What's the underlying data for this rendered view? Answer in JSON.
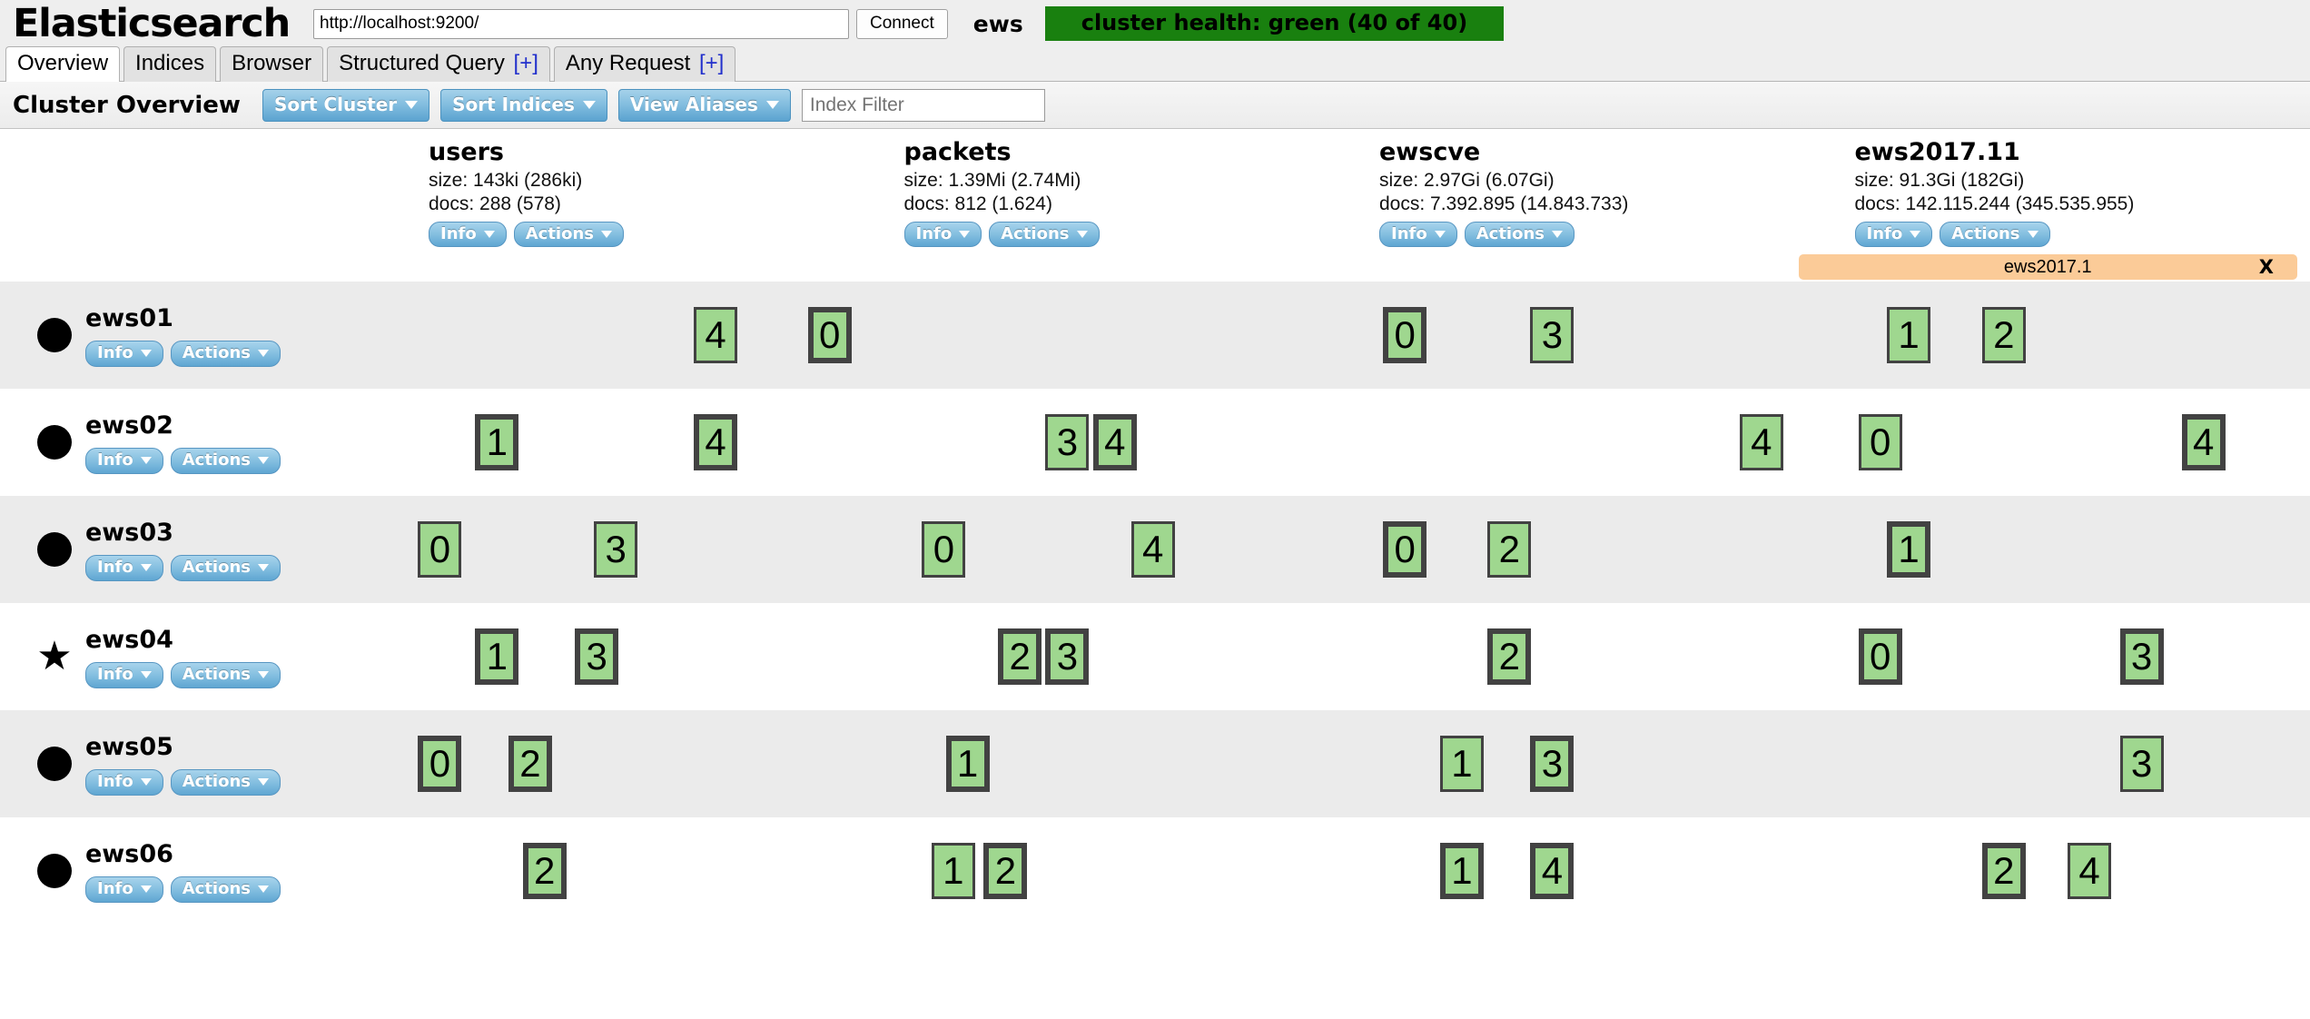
{
  "header": {
    "brand": "Elasticsearch",
    "url_value": "http://localhost:9200/",
    "url_placeholder": "http://localhost:9200/",
    "connect_label": "Connect",
    "cluster_name": "ews",
    "health_text": "cluster health: green (40 of 40)",
    "health_color": "#19800f"
  },
  "tabs": [
    {
      "label": "Overview",
      "plus": "",
      "active": true
    },
    {
      "label": "Indices",
      "plus": "",
      "active": false
    },
    {
      "label": "Browser",
      "plus": "",
      "active": false
    },
    {
      "label": "Structured Query",
      "plus": "[+]",
      "active": false
    },
    {
      "label": "Any Request",
      "plus": "[+]",
      "active": false
    }
  ],
  "toolbar": {
    "title": "Cluster Overview",
    "sort_cluster_label": "Sort Cluster",
    "sort_indices_label": "Sort Indices",
    "view_aliases_label": "View Aliases",
    "filter_placeholder": "Index Filter",
    "filter_value": ""
  },
  "pill_labels": {
    "info": "Info",
    "actions": "Actions"
  },
  "indices": [
    {
      "name": "users",
      "size": "size: 143ki (286ki)",
      "docs": "docs: 288 (578)",
      "alias": null
    },
    {
      "name": "packets",
      "size": "size: 1.39Mi (2.74Mi)",
      "docs": "docs: 812 (1.624)",
      "alias": null
    },
    {
      "name": "ewscve",
      "size": "size: 2.97Gi (6.07Gi)",
      "docs": "docs: 7.392.895 (14.843.733)",
      "alias": null
    },
    {
      "name": "ews2017.11",
      "size": "size: 91.3Gi (182Gi)",
      "docs": "docs: 142.115.244 (345.535.955)",
      "alias": {
        "label": "ews2017.1",
        "close": "X"
      }
    }
  ],
  "nodes": [
    {
      "name": "ews01",
      "marker": "circle-icon",
      "master": false,
      "shards": [
        {
          "index": 0,
          "num": "4",
          "primary": false,
          "x": 0.6
        },
        {
          "index": 0,
          "num": "0",
          "primary": true,
          "x": 0.84
        },
        {
          "index": 2,
          "num": "0",
          "primary": true,
          "x": 0.05
        },
        {
          "index": 2,
          "num": "3",
          "primary": false,
          "x": 0.36
        },
        {
          "index": 3,
          "num": "1",
          "primary": false,
          "x": 0.11
        },
        {
          "index": 3,
          "num": "2",
          "primary": false,
          "x": 0.31
        }
      ]
    },
    {
      "name": "ews02",
      "marker": "circle-icon",
      "master": false,
      "shards": [
        {
          "index": 0,
          "num": "1",
          "primary": true,
          "x": 0.14
        },
        {
          "index": 0,
          "num": "4",
          "primary": true,
          "x": 0.6
        },
        {
          "index": 1,
          "num": "3",
          "primary": false,
          "x": 0.34
        },
        {
          "index": 1,
          "num": "4",
          "primary": true,
          "x": 0.44
        },
        {
          "index": 2,
          "num": "4",
          "primary": false,
          "x": 0.8
        },
        {
          "index": 3,
          "num": "0",
          "primary": false,
          "x": 0.05
        },
        {
          "index": 3,
          "num": "4",
          "primary": true,
          "x": 0.73
        }
      ]
    },
    {
      "name": "ews03",
      "marker": "circle-icon",
      "master": false,
      "shards": [
        {
          "index": 0,
          "num": "0",
          "primary": false,
          "x": 0.02
        },
        {
          "index": 0,
          "num": "3",
          "primary": false,
          "x": 0.39
        },
        {
          "index": 1,
          "num": "0",
          "primary": false,
          "x": 0.08
        },
        {
          "index": 1,
          "num": "4",
          "primary": false,
          "x": 0.52
        },
        {
          "index": 2,
          "num": "0",
          "primary": true,
          "x": 0.05
        },
        {
          "index": 2,
          "num": "2",
          "primary": false,
          "x": 0.27
        },
        {
          "index": 3,
          "num": "1",
          "primary": true,
          "x": 0.11
        }
      ]
    },
    {
      "name": "ews04",
      "marker": "star-icon",
      "master": true,
      "shards": [
        {
          "index": 0,
          "num": "1",
          "primary": true,
          "x": 0.14
        },
        {
          "index": 0,
          "num": "3",
          "primary": true,
          "x": 0.35
        },
        {
          "index": 1,
          "num": "2",
          "primary": true,
          "x": 0.24
        },
        {
          "index": 1,
          "num": "3",
          "primary": true,
          "x": 0.34
        },
        {
          "index": 2,
          "num": "2",
          "primary": true,
          "x": 0.27
        },
        {
          "index": 3,
          "num": "0",
          "primary": true,
          "x": 0.05
        },
        {
          "index": 3,
          "num": "3",
          "primary": true,
          "x": 0.6
        }
      ]
    },
    {
      "name": "ews05",
      "marker": "circle-icon",
      "master": false,
      "shards": [
        {
          "index": 0,
          "num": "0",
          "primary": true,
          "x": 0.02
        },
        {
          "index": 0,
          "num": "2",
          "primary": true,
          "x": 0.21
        },
        {
          "index": 1,
          "num": "1",
          "primary": true,
          "x": 0.13
        },
        {
          "index": 2,
          "num": "1",
          "primary": false,
          "x": 0.17
        },
        {
          "index": 2,
          "num": "3",
          "primary": true,
          "x": 0.36
        },
        {
          "index": 3,
          "num": "3",
          "primary": false,
          "x": 0.6
        }
      ]
    },
    {
      "name": "ews06",
      "marker": "circle-icon",
      "master": false,
      "shards": [
        {
          "index": 0,
          "num": "2",
          "primary": true,
          "x": 0.24
        },
        {
          "index": 1,
          "num": "1",
          "primary": false,
          "x": 0.1
        },
        {
          "index": 1,
          "num": "2",
          "primary": true,
          "x": 0.21
        },
        {
          "index": 2,
          "num": "1",
          "primary": true,
          "x": 0.17
        },
        {
          "index": 2,
          "num": "4",
          "primary": true,
          "x": 0.36
        },
        {
          "index": 3,
          "num": "2",
          "primary": true,
          "x": 0.31
        },
        {
          "index": 3,
          "num": "4",
          "primary": false,
          "x": 0.49
        }
      ]
    }
  ]
}
